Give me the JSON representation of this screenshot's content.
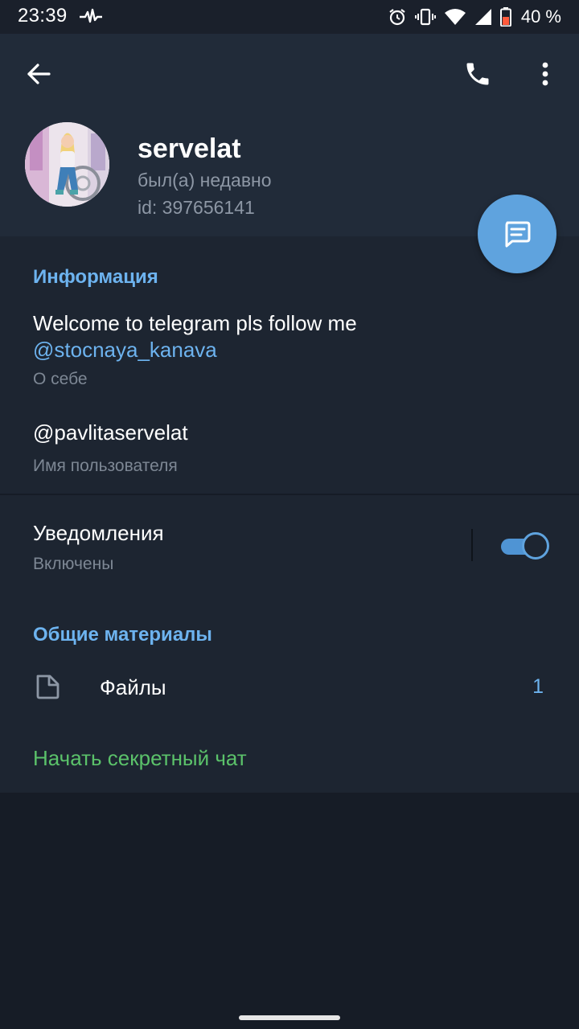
{
  "status_bar": {
    "time": "23:39",
    "battery": "40 %"
  },
  "toolbar": {
    "back_icon": "arrow-left-icon",
    "call_icon": "phone-icon",
    "more_icon": "more-vertical-icon"
  },
  "profile": {
    "name": "servelat",
    "status": "был(а) недавно",
    "id": "id: 397656141"
  },
  "info": {
    "section_title": "Информация",
    "bio_text": "Welcome to telegram pls follow me",
    "bio_link": "@stocnaya_kanava",
    "bio_hint": "О себе",
    "username": "@pavlitaservelat",
    "username_hint": "Имя пользователя"
  },
  "notifications": {
    "title": "Уведомления",
    "state": "Включены",
    "enabled": true
  },
  "shared_media": {
    "section_title": "Общие материалы",
    "files_label": "Файлы",
    "files_count": "1"
  },
  "secret_chat": {
    "label": "Начать секретный чат"
  },
  "colors": {
    "header_bg": "#212b39",
    "content_bg": "#1d2531",
    "accent_blue": "#6db3ef",
    "fab_blue": "#5fa3de",
    "secret_green": "#5bc26a"
  }
}
